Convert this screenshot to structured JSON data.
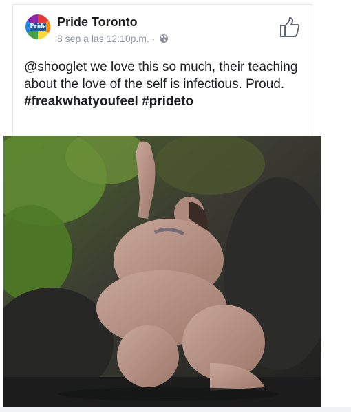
{
  "post": {
    "author": "Pride Toronto",
    "avatar_text": "Pride",
    "timestamp": "8 sep a las 12:10p.m.",
    "separator": "·",
    "privacy_icon": "globe-icon",
    "like_icon": "thumbs-up-outline-icon",
    "text": "@shooglet we love this so much, their teaching about the love of the self is infectious. Proud.",
    "hashtags": [
      "#freakwhatyoufeel",
      "#prideto"
    ]
  },
  "photo": {
    "icon": "photo-image"
  },
  "colors": {
    "name": "#1c1e21",
    "meta": "#8d949e",
    "brand": "#1d5ea8",
    "background": "#f0f2f5"
  }
}
